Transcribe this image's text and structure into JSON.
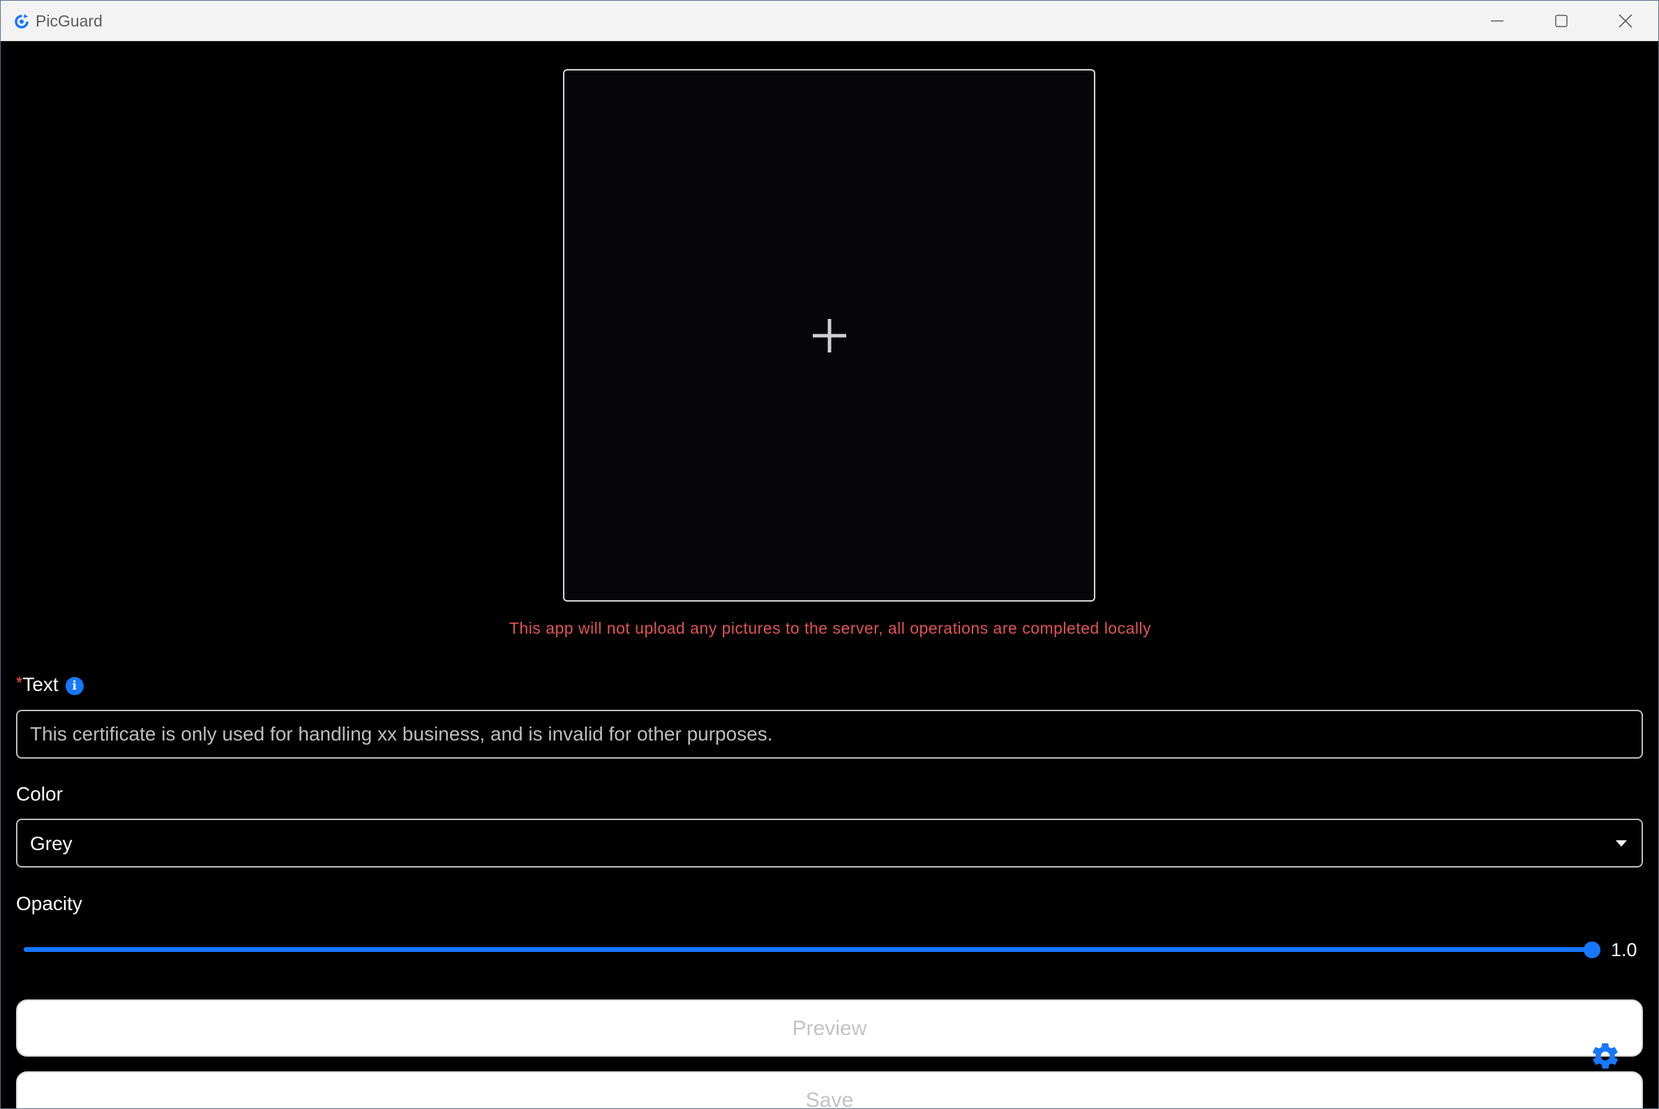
{
  "window": {
    "title": "PicGuard"
  },
  "upload": {
    "notice": "This app will not upload any pictures to the server, all operations are completed locally"
  },
  "form": {
    "text": {
      "required_mark": "*",
      "label": "Text",
      "placeholder": "This certificate is only used for handling xx business, and is invalid for other purposes."
    },
    "color": {
      "label": "Color",
      "value": "Grey"
    },
    "opacity": {
      "label": "Opacity",
      "value": 1.0,
      "value_text": "1.0",
      "min": 0,
      "max": 1
    }
  },
  "actions": {
    "preview_label": "Preview",
    "save_label": "Save"
  },
  "colors": {
    "accent": "#1677ff",
    "notice": "#e05454",
    "required": "#ff4d4f"
  },
  "icons": {
    "app": "picguard-logo-icon",
    "upload": "plus-icon",
    "info": "info-icon",
    "dropdown": "caret-down-icon",
    "settings": "gear-icon"
  }
}
